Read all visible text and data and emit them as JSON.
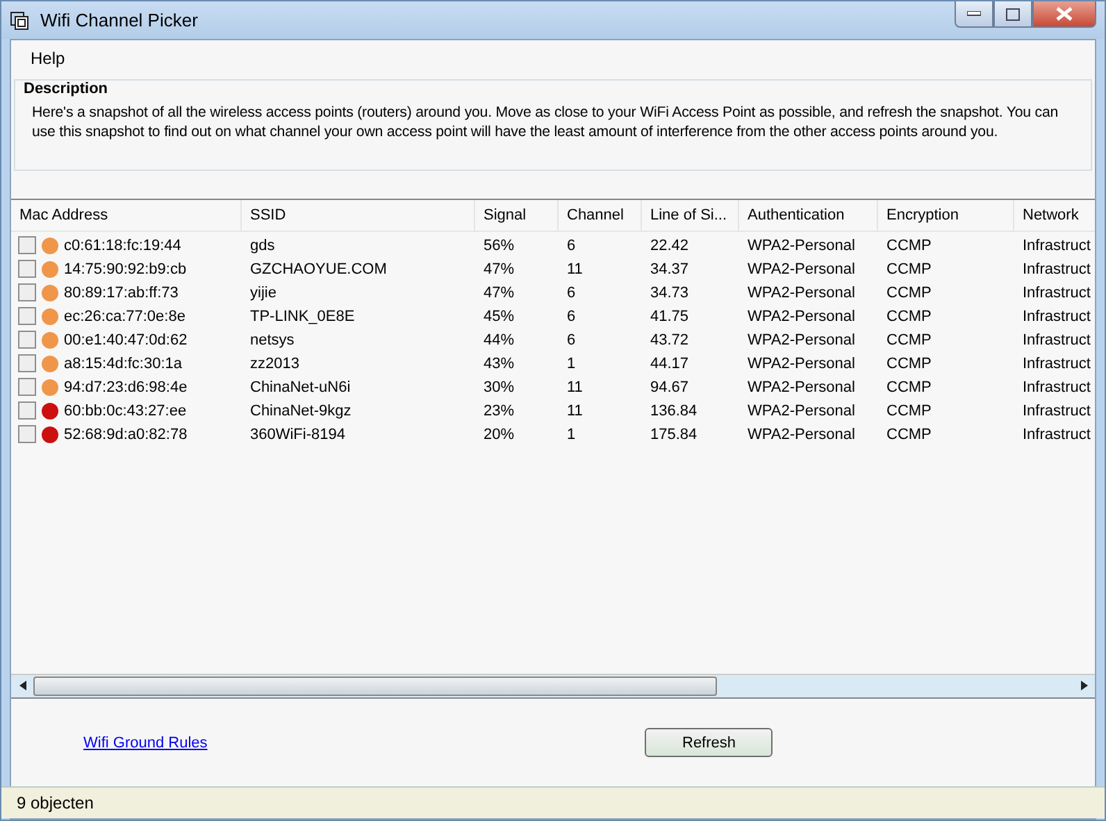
{
  "window": {
    "title": "Wifi Channel Picker"
  },
  "menu": [
    "Help"
  ],
  "description": {
    "title": "Description",
    "text": "Here's a snapshot of all the wireless access points (routers) around you. Move as close to your WiFi Access Point as possible, and refresh the snapshot. You can use this snapshot to find out on what channel your own access point will have the least amount of interference from the other access points around you."
  },
  "table": {
    "columns": [
      "Mac Address",
      "SSID",
      "Signal",
      "Channel",
      "Line of Si...",
      "Authentication",
      "Encryption",
      "Network"
    ],
    "rows": [
      {
        "checked": false,
        "color": "#f0964a",
        "cells": [
          "c0:61:18:fc:19:44",
          "gds",
          "56%",
          "6",
          "22.42",
          "WPA2-Personal",
          "CCMP",
          "Infrastruct"
        ]
      },
      {
        "checked": false,
        "color": "#f0964a",
        "cells": [
          "14:75:90:92:b9:cb",
          "GZCHAOYUE.COM",
          "47%",
          "11",
          "34.37",
          "WPA2-Personal",
          "CCMP",
          "Infrastruct"
        ]
      },
      {
        "checked": false,
        "color": "#f0964a",
        "cells": [
          "80:89:17:ab:ff:73",
          "yijie",
          "47%",
          "6",
          "34.73",
          "WPA2-Personal",
          "CCMP",
          "Infrastruct"
        ]
      },
      {
        "checked": false,
        "color": "#f0964a",
        "cells": [
          "ec:26:ca:77:0e:8e",
          "TP-LINK_0E8E",
          "45%",
          "6",
          "41.75",
          "WPA2-Personal",
          "CCMP",
          "Infrastruct"
        ]
      },
      {
        "checked": false,
        "color": "#f0964a",
        "cells": [
          "00:e1:40:47:0d:62",
          "netsys",
          "44%",
          "6",
          "43.72",
          "WPA2-Personal",
          "CCMP",
          "Infrastruct"
        ]
      },
      {
        "checked": false,
        "color": "#f0964a",
        "cells": [
          "a8:15:4d:fc:30:1a",
          "zz2013",
          "43%",
          "1",
          "44.17",
          "WPA2-Personal",
          "CCMP",
          "Infrastruct"
        ]
      },
      {
        "checked": false,
        "color": "#f0964a",
        "cells": [
          "94:d7:23:d6:98:4e",
          "ChinaNet-uN6i",
          "30%",
          "11",
          "94.67",
          "WPA2-Personal",
          "CCMP",
          "Infrastruct"
        ]
      },
      {
        "checked": false,
        "color": "#cc1010",
        "cells": [
          "60:bb:0c:43:27:ee",
          "ChinaNet-9kgz",
          "23%",
          "11",
          "136.84",
          "WPA2-Personal",
          "CCMP",
          "Infrastruct"
        ]
      },
      {
        "checked": false,
        "color": "#cc1010",
        "cells": [
          "52:68:9d:a0:82:78",
          "360WiFi-8194",
          "20%",
          "1",
          "175.84",
          "WPA2-Personal",
          "CCMP",
          "Infrastruct"
        ]
      }
    ]
  },
  "link": "Wifi Ground Rules",
  "button": "Refresh",
  "status_bar": "9 objecten"
}
